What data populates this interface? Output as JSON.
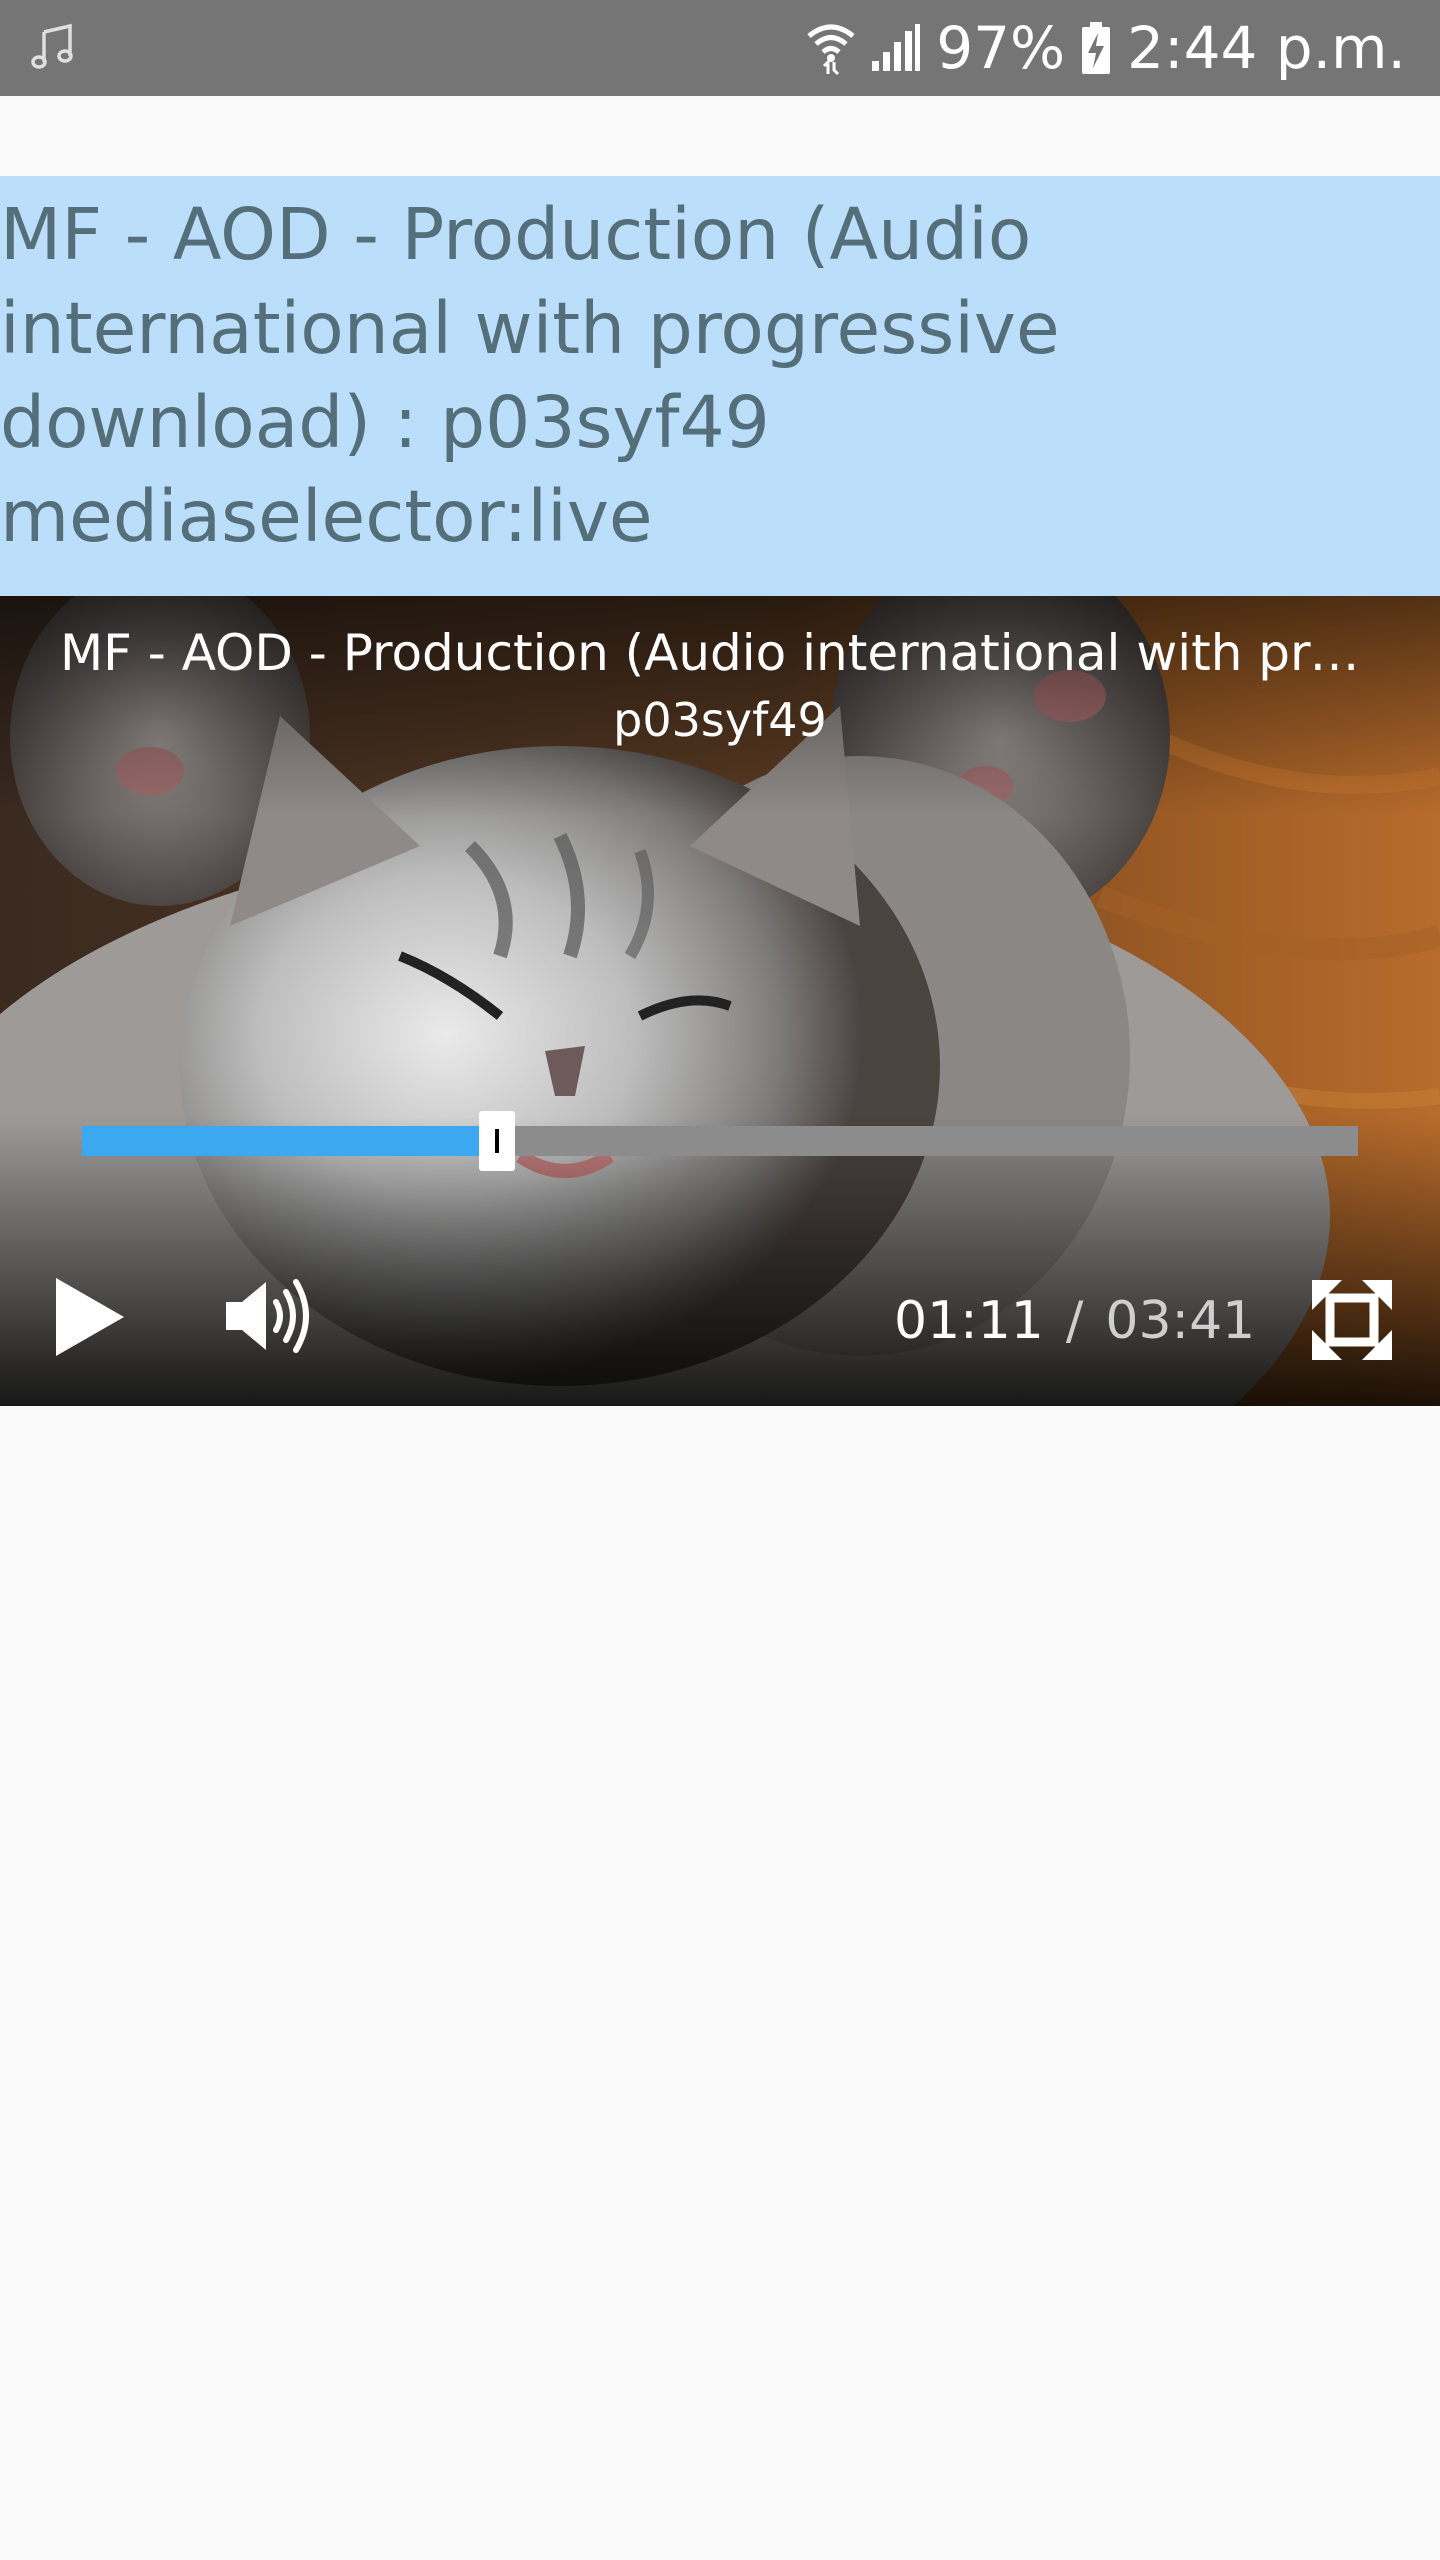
{
  "status_bar": {
    "notification_icon": "music-note-icon",
    "wifi_icon": "wifi-icon",
    "signal_icon": "cell-signal-icon",
    "battery_level": "97%",
    "battery_icon": "battery-charging-icon",
    "time": "2:44 p.m."
  },
  "page": {
    "title": "MF - AOD - Production (Audio international with progressive download) : p03syf49 mediaselector:live"
  },
  "player": {
    "title": "MF - AOD - Production (Audio international with progressive download)",
    "subtitle": "p03syf49",
    "artwork": "sleeping-kitten-artwork",
    "progress_fraction": 0.325,
    "progress_color": "#3ba8f0",
    "current_time": "01:11",
    "separator": "/",
    "total_time": "03:41",
    "controls": {
      "play_icon": "play-icon",
      "volume_icon": "volume-icon",
      "fullscreen_icon": "fullscreen-icon"
    }
  }
}
